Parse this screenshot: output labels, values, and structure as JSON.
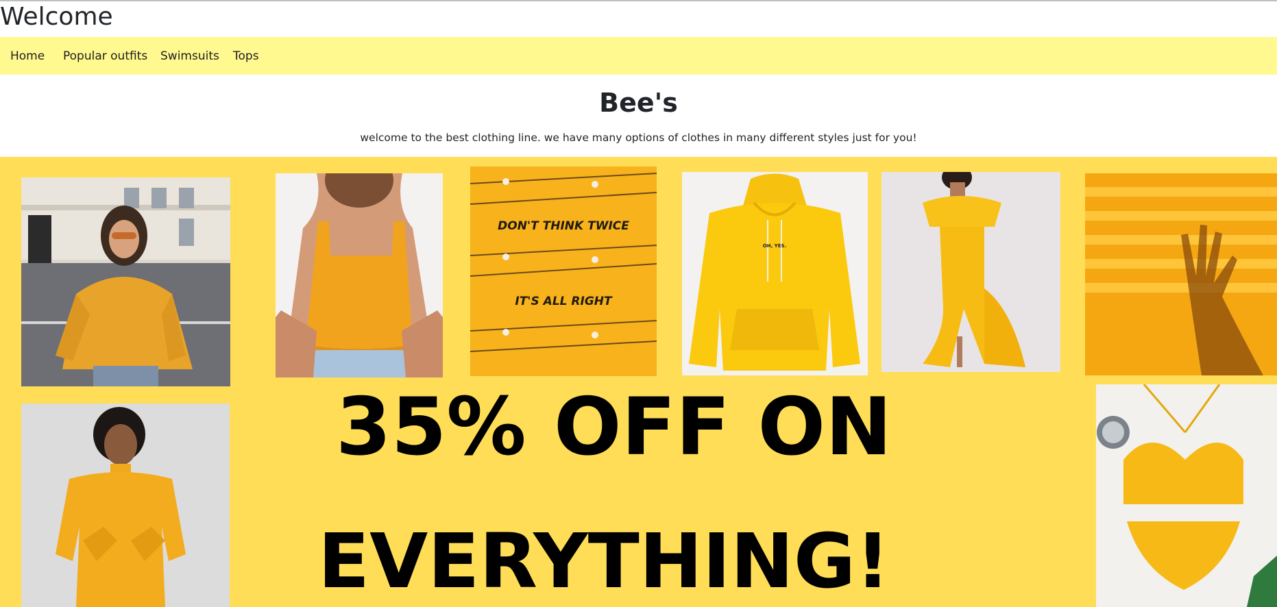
{
  "header": {
    "title": "Welcome"
  },
  "nav": {
    "items": [
      {
        "label": "Home"
      },
      {
        "label": "Popular outfits"
      },
      {
        "label": "Swimsuits"
      },
      {
        "label": "Tops"
      }
    ]
  },
  "hero": {
    "title": "Bee's",
    "tagline": "welcome to the best clothing line. we have many options of clothes in many different styles just for you!"
  },
  "promo": {
    "line1": "35% OFF ON",
    "line2": "EVERYTHING!",
    "background_color": "#ffdd57",
    "poster_texts": [
      "DON'T THINK TWICE",
      "IT'S ALL RIGHT"
    ],
    "hoodie_print": "OH, YES."
  },
  "colors": {
    "nav_background": "#fff98f",
    "garment_yellow": "#f7b81c"
  }
}
